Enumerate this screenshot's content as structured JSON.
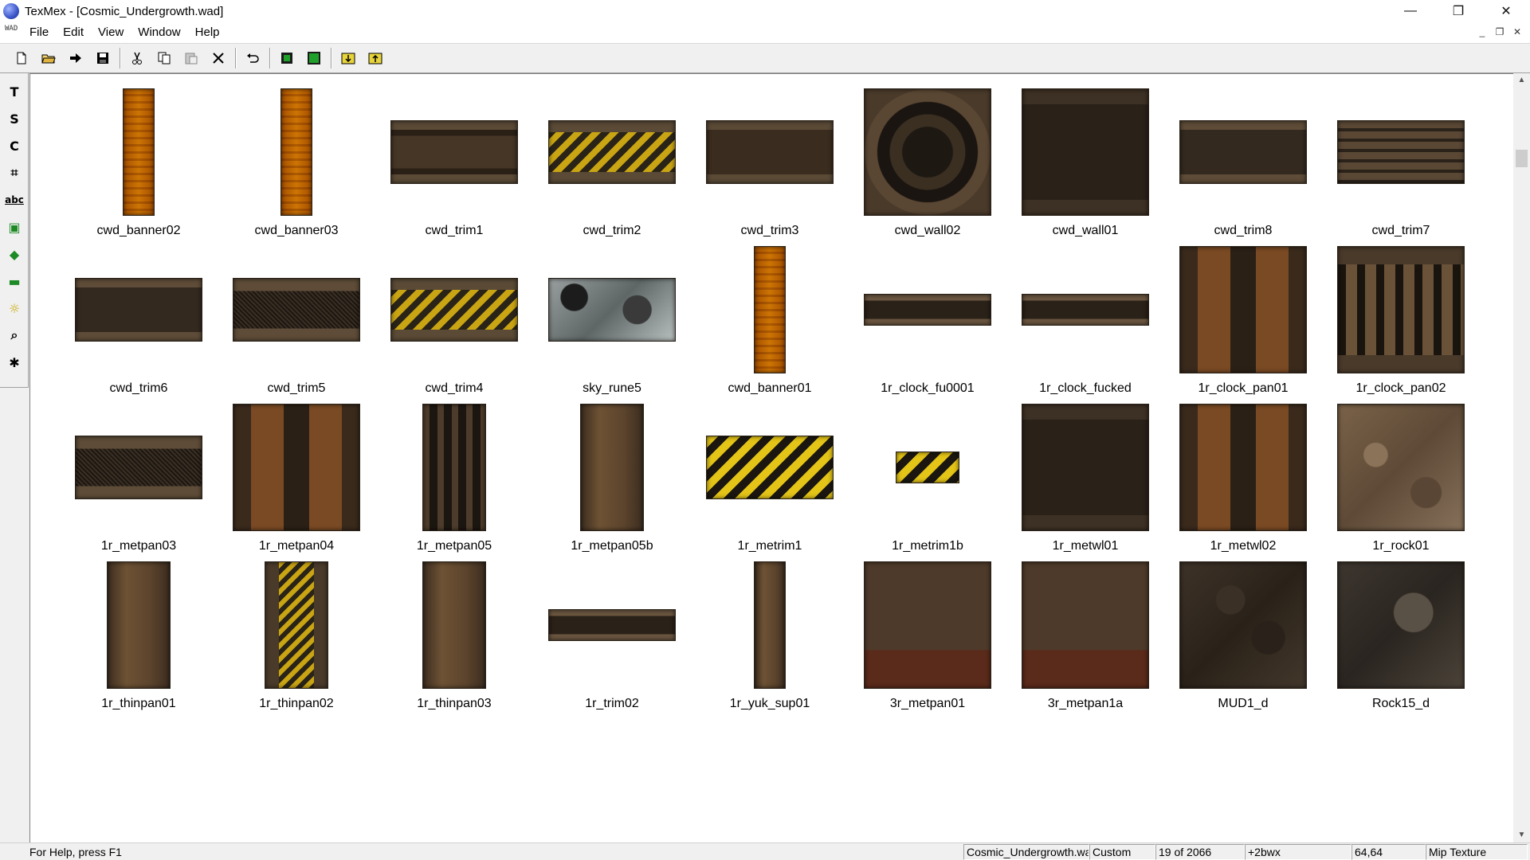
{
  "window": {
    "title": "TexMex - [Cosmic_Undergrowth.wad]",
    "minimize": "—",
    "maximize": "❐",
    "close": "✕"
  },
  "menu": {
    "doc_icon": "WAD",
    "items": [
      "File",
      "Edit",
      "View",
      "Window",
      "Help"
    ],
    "mdi_minimize": "_",
    "mdi_restore": "❐",
    "mdi_close": "✕"
  },
  "toolbar": {
    "icons": [
      "new-file-icon",
      "open-folder-icon",
      "forward-arrow-icon",
      "save-icon",
      "cut-icon",
      "copy-icon",
      "paste-icon",
      "delete-icon",
      "undo-icon",
      "fit-small-icon",
      "fit-large-icon",
      "import-icon",
      "export-icon"
    ]
  },
  "tools": {
    "items": [
      "T",
      "S",
      "C",
      "⌗",
      "abc",
      "▣",
      "◆",
      "▬",
      "☼",
      "⌕",
      "✱"
    ]
  },
  "textures": [
    {
      "name": "cwd_banner02",
      "kind": "banner_yellow",
      "w": 40,
      "h": 160
    },
    {
      "name": "cwd_banner03",
      "kind": "banner_yellow",
      "w": 40,
      "h": 160
    },
    {
      "name": "cwd_trim1",
      "kind": "trim_light",
      "w": 160,
      "h": 80
    },
    {
      "name": "cwd_trim2",
      "kind": "trim_hazard",
      "w": 160,
      "h": 80
    },
    {
      "name": "cwd_trim3",
      "kind": "trim_section",
      "w": 160,
      "h": 80
    },
    {
      "name": "cwd_wall02",
      "kind": "wall_grate",
      "w": 160,
      "h": 160
    },
    {
      "name": "cwd_wall01",
      "kind": "wall_panel",
      "w": 160,
      "h": 160
    },
    {
      "name": "cwd_trim8",
      "kind": "trim_plain",
      "w": 160,
      "h": 80
    },
    {
      "name": "cwd_trim7",
      "kind": "trim_lines",
      "w": 160,
      "h": 80
    },
    {
      "name": "cwd_trim6",
      "kind": "trim_plain",
      "w": 160,
      "h": 80
    },
    {
      "name": "cwd_trim5",
      "kind": "trim_mesh",
      "w": 160,
      "h": 80
    },
    {
      "name": "cwd_trim4",
      "kind": "trim_hazard",
      "w": 160,
      "h": 80
    },
    {
      "name": "sky_rune5",
      "kind": "sky",
      "w": 160,
      "h": 80
    },
    {
      "name": "cwd_banner01",
      "kind": "banner_yellow",
      "w": 40,
      "h": 160
    },
    {
      "name": "1r_clock_fu0001",
      "kind": "strip_dark",
      "w": 160,
      "h": 40
    },
    {
      "name": "1r_clock_fucked",
      "kind": "strip_dark",
      "w": 160,
      "h": 40
    },
    {
      "name": "1r_clock_pan01",
      "kind": "panel_rust",
      "w": 160,
      "h": 160
    },
    {
      "name": "1r_clock_pan02",
      "kind": "panel_vents",
      "w": 160,
      "h": 160
    },
    {
      "name": "1r_metpan03",
      "kind": "trim_mesh",
      "w": 160,
      "h": 80
    },
    {
      "name": "1r_metpan04",
      "kind": "panel_rust",
      "w": 160,
      "h": 160
    },
    {
      "name": "1r_metpan05",
      "kind": "column_dark",
      "w": 80,
      "h": 160
    },
    {
      "name": "1r_metpan05b",
      "kind": "column_rust",
      "w": 80,
      "h": 160
    },
    {
      "name": "1r_metrim1",
      "kind": "hazard_big",
      "w": 160,
      "h": 80
    },
    {
      "name": "1r_metrim1b",
      "kind": "hazard_big",
      "w": 80,
      "h": 40
    },
    {
      "name": "1r_metwl01",
      "kind": "wall_panel",
      "w": 160,
      "h": 160
    },
    {
      "name": "1r_metwl02",
      "kind": "panel_rust",
      "w": 160,
      "h": 160
    },
    {
      "name": "1r_rock01",
      "kind": "rock_light",
      "w": 160,
      "h": 160
    },
    {
      "name": "1r_thinpan01",
      "kind": "column_rust",
      "w": 80,
      "h": 160
    },
    {
      "name": "1r_thinpan02",
      "kind": "column_hazard",
      "w": 80,
      "h": 160
    },
    {
      "name": "1r_thinpan03",
      "kind": "column_rust",
      "w": 80,
      "h": 160
    },
    {
      "name": "1r_trim02",
      "kind": "strip_dark",
      "w": 160,
      "h": 40
    },
    {
      "name": "1r_yuk_sup01",
      "kind": "column_rust",
      "w": 40,
      "h": 160
    },
    {
      "name": "3r_metpan01",
      "kind": "wall_rust",
      "w": 160,
      "h": 160
    },
    {
      "name": "3r_metpan1a",
      "kind": "wall_rust",
      "w": 160,
      "h": 160
    },
    {
      "name": "MUD1_d",
      "kind": "mud",
      "w": 160,
      "h": 160
    },
    {
      "name": "Rock15_d",
      "kind": "rock_dark",
      "w": 160,
      "h": 160
    }
  ],
  "status": {
    "help": "For Help, press F1",
    "file": "Cosmic_Undergrowth.wad",
    "mode": "Custom",
    "count": "19 of 2066",
    "flags": "+2bwx",
    "size": "64,64",
    "type": "Mip Texture"
  }
}
